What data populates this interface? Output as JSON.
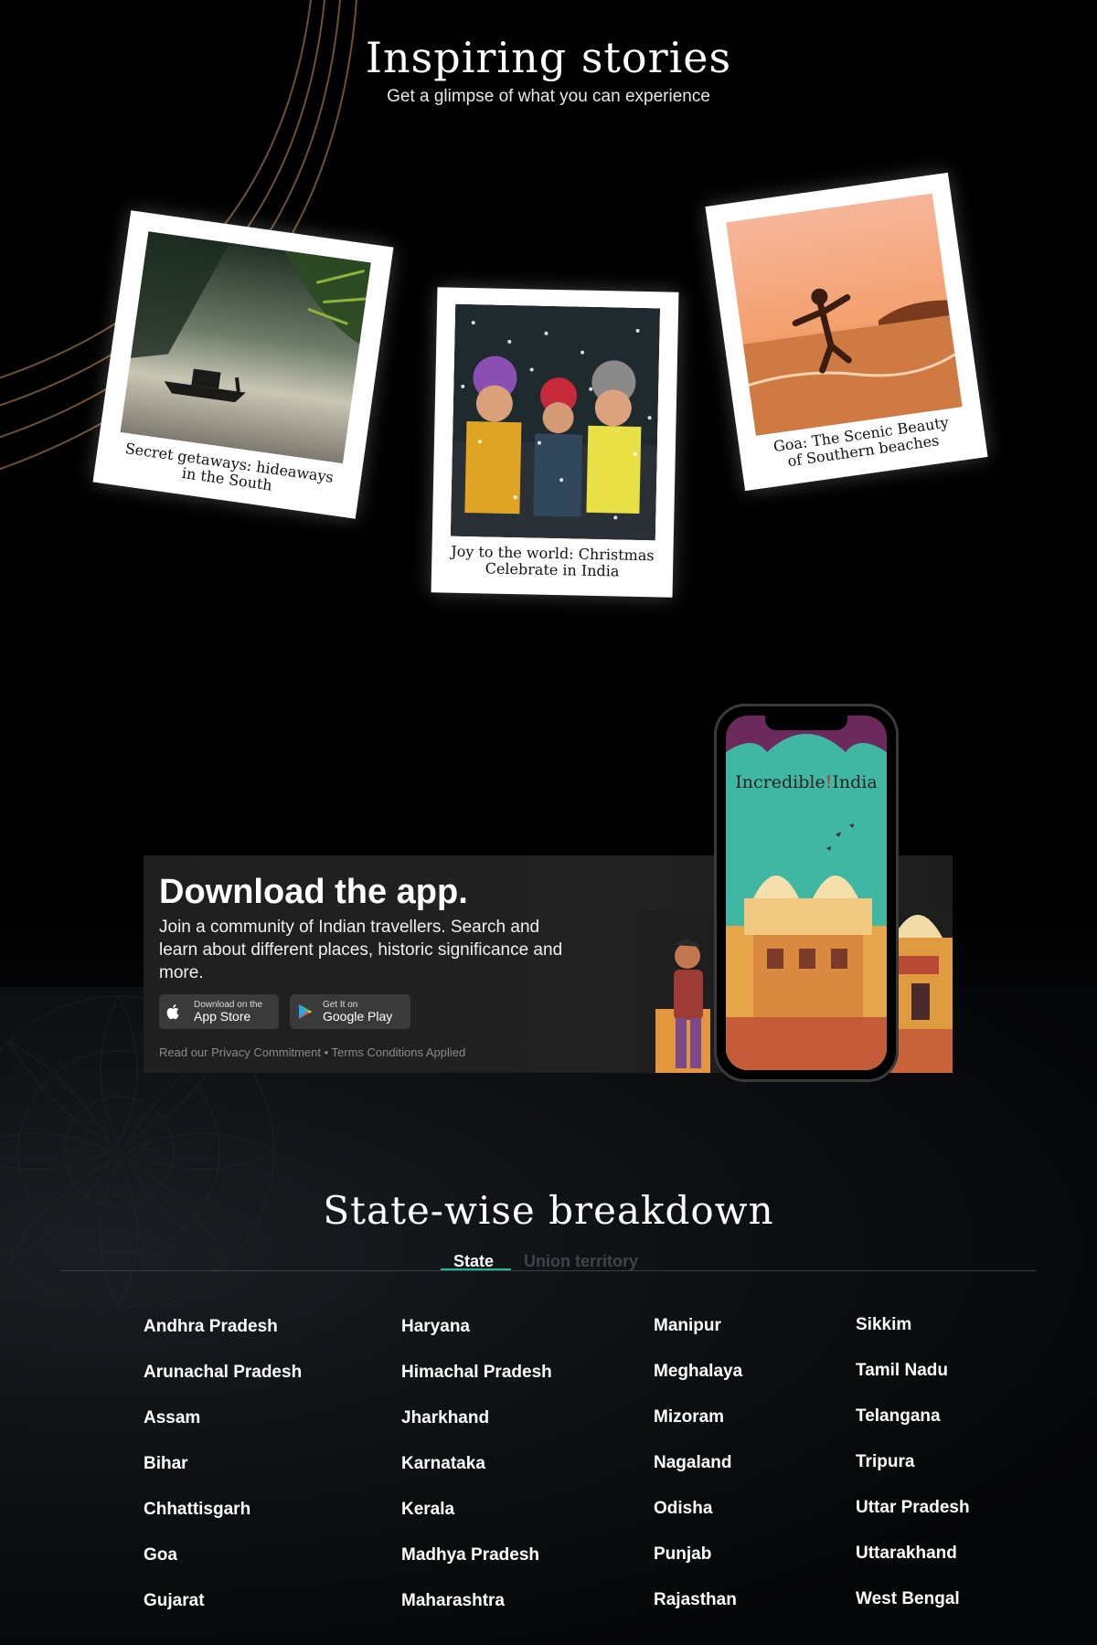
{
  "stories": {
    "title": "Inspiring stories",
    "subtitle": "Get a glimpse of what you can experience",
    "cards": [
      {
        "caption_line1": "Secret getaways: hideaways",
        "caption_line2": "in the South"
      },
      {
        "caption_line1": "Joy to the world: Christmas",
        "caption_line2": "Celebrate in India"
      },
      {
        "caption_line1": "Goa: The Scenic Beauty",
        "caption_line2": "of Southern beaches"
      }
    ]
  },
  "app": {
    "title": "Download the app.",
    "description": "Join a community of Indian travellers. Search and learn about different places, historic significance and more.",
    "appstore_small": "Download on the",
    "appstore_big": "App Store",
    "googleplay_small": "Get It on",
    "googleplay_big": "Google Play",
    "fineprint": "Read our Privacy Commitment • Terms Conditions Applied",
    "phone_brand_left": "Incredible",
    "phone_brand_right": "India",
    "icons": [
      "apple-icon",
      "google-play-icon"
    ]
  },
  "breakdown": {
    "title": "State-wise breakdown",
    "tabs": [
      {
        "label": "State",
        "active": true
      },
      {
        "label": "Union territory",
        "active": false
      }
    ],
    "accent_color": "#1dba9a",
    "columns": [
      [
        "Andhra Pradesh",
        "Arunachal Pradesh",
        "Assam",
        "Bihar",
        "Chhattisgarh",
        "Goa",
        "Gujarat"
      ],
      [
        "Haryana",
        "Himachal Pradesh",
        "Jharkhand",
        "Karnataka",
        "Kerala",
        "Madhya Pradesh",
        "Maharashtra"
      ],
      [
        "Manipur",
        "Meghalaya",
        "Mizoram",
        "Nagaland",
        "Odisha",
        "Punjab",
        "Rajasthan"
      ],
      [
        "Sikkim",
        "Tamil Nadu",
        "Telangana",
        "Tripura",
        "Uttar Pradesh",
        "Uttarakhand",
        "West Bengal"
      ]
    ]
  }
}
